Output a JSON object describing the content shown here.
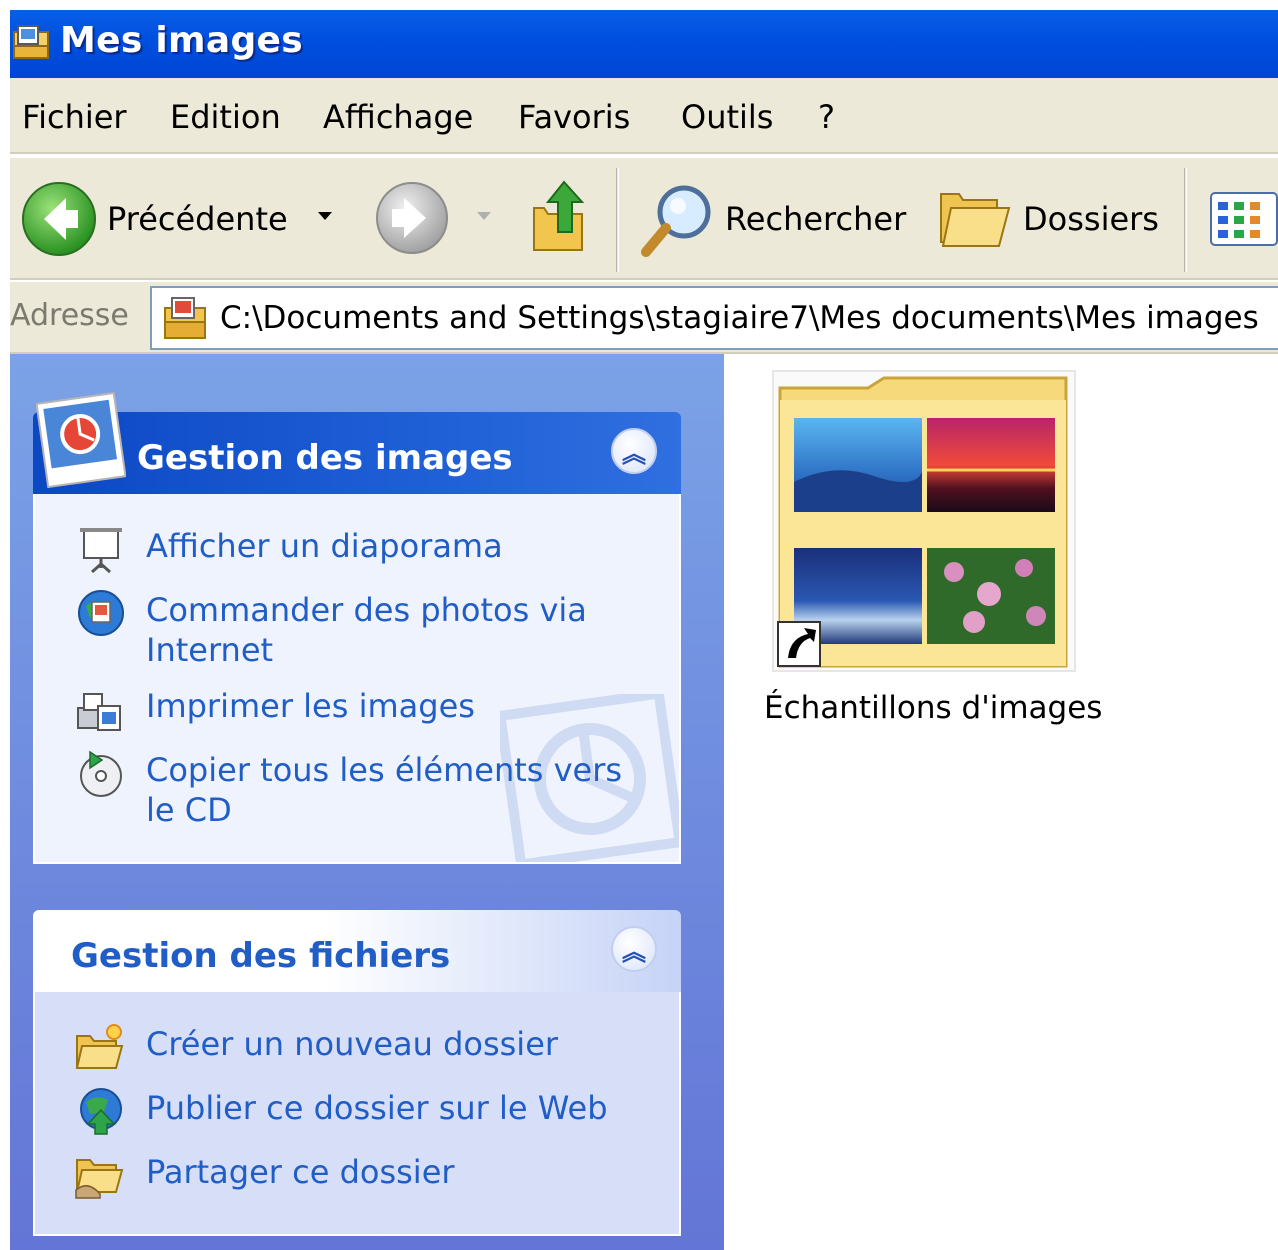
{
  "window": {
    "title": "Mes images"
  },
  "menu": [
    "Fichier",
    "Edition",
    "Affichage",
    "Favoris",
    "Outils",
    "?"
  ],
  "toolbar": {
    "back_label": "Précédente",
    "search_label": "Rechercher",
    "folders_label": "Dossiers"
  },
  "address": {
    "label": "Adresse",
    "path": "C:\\Documents and Settings\\stagiaire7\\Mes documents\\Mes images"
  },
  "tasks": {
    "image_panel": {
      "title": "Gestion des images",
      "items": [
        {
          "label_lines": [
            "Afficher un diaporama"
          ],
          "icon": "slideshow-icon"
        },
        {
          "label_lines": [
            "Commander des photos via",
            "Internet"
          ],
          "icon": "order-photos-icon"
        },
        {
          "label_lines": [
            "Imprimer les images"
          ],
          "icon": "print-images-icon"
        },
        {
          "label_lines": [
            "Copier tous les éléments vers",
            "le CD"
          ],
          "icon": "copy-to-cd-icon"
        }
      ]
    },
    "file_panel": {
      "title": "Gestion des fichiers",
      "items": [
        {
          "label": "Créer un nouveau dossier",
          "icon": "new-folder-icon"
        },
        {
          "label": "Publier ce dossier sur le Web",
          "icon": "publish-web-icon"
        },
        {
          "label": "Partager ce dossier",
          "icon": "share-folder-icon"
        }
      ]
    }
  },
  "content": {
    "items": [
      {
        "label": "Échantillons d'images",
        "icon": "sample-pictures-shortcut-icon"
      }
    ]
  },
  "colors": {
    "title_bar": "#0050e0",
    "chrome": "#ece9d8",
    "task_link": "#215dc6",
    "task_pane": "#7ba2e7"
  }
}
